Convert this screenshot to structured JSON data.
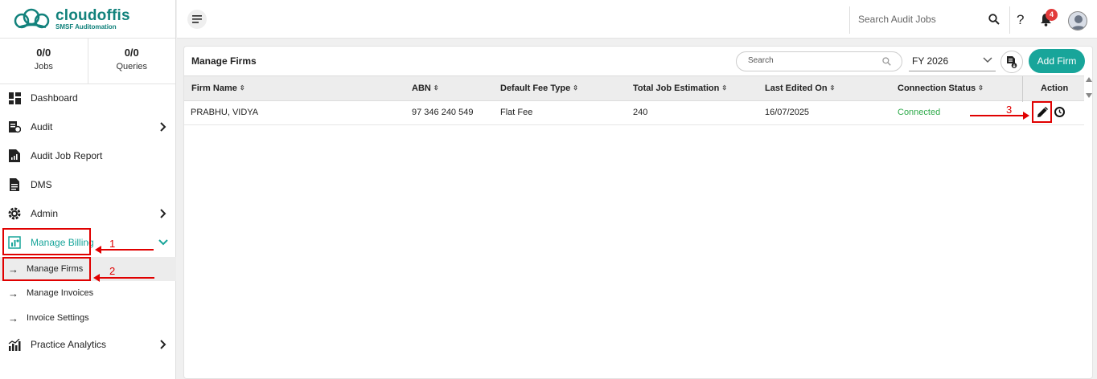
{
  "brand": {
    "name": "cloudoffis",
    "tagline": "SMSF Auditomation",
    "accent": "#18a59a"
  },
  "stats": [
    {
      "value": "0/0",
      "label": "Jobs"
    },
    {
      "value": "0/0",
      "label": "Queries"
    }
  ],
  "sidebar": {
    "items": [
      {
        "label": "Dashboard",
        "icon": "dashboard-icon"
      },
      {
        "label": "Audit",
        "icon": "audit-icon"
      },
      {
        "label": "Audit Job Report",
        "icon": "report-icon"
      },
      {
        "label": "DMS",
        "icon": "document-icon"
      },
      {
        "label": "Admin",
        "icon": "gear-icon"
      },
      {
        "label": "Manage Billing",
        "icon": "billing-icon"
      },
      {
        "label": "Practice Analytics",
        "icon": "analytics-icon"
      }
    ],
    "billing_sub": [
      {
        "label": "Manage Firms"
      },
      {
        "label": "Manage Invoices"
      },
      {
        "label": "Invoice Settings"
      }
    ]
  },
  "header": {
    "search_placeholder": "Search Audit Jobs",
    "help": "?",
    "notification_count": "4"
  },
  "main": {
    "title": "Manage Firms",
    "search_placeholder": "Search",
    "fy_selected": "FY 2026",
    "add_button": "Add Firm",
    "columns": [
      "Firm Name",
      "ABN",
      "Default Fee Type",
      "Total Job Estimation",
      "Last Edited On",
      "Connection Status",
      "Action"
    ],
    "rows": [
      {
        "firm_name": "PRABHU, VIDYA",
        "abn": "97 346 240 549",
        "fee_type": "Flat Fee",
        "job_estimation": "240",
        "last_edited": "16/07/2025",
        "status": "Connected"
      }
    ]
  },
  "annotations": {
    "one": "1",
    "two": "2",
    "three": "3"
  }
}
